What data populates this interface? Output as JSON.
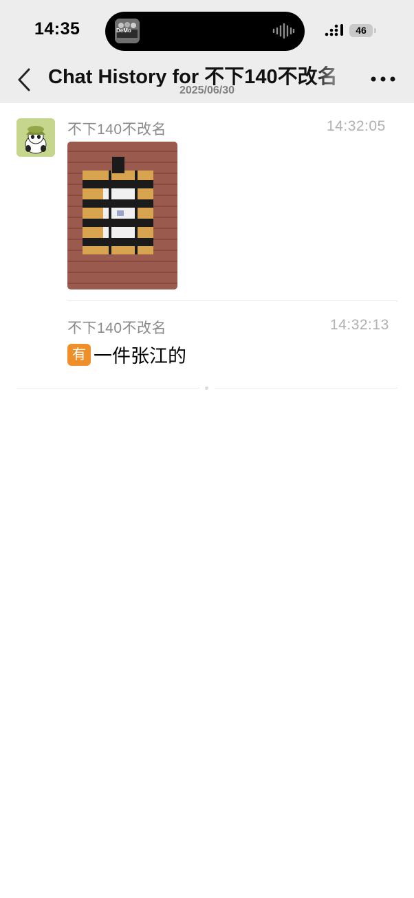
{
  "status_bar": {
    "time": "14:35",
    "battery": "46",
    "island_art_text": "DeMo",
    "icons": [
      "dynamic-island-album-art",
      "audio-waveform-icon",
      "cellular-signal-icon",
      "battery-icon"
    ]
  },
  "header": {
    "title": "Chat History for 不下140不改名",
    "subtitle": "2025/06/30",
    "icons": [
      "chevron-left-icon",
      "more-dots-icon"
    ]
  },
  "messages": [
    {
      "sender": "不下140不改名",
      "time": "14:32:05",
      "type": "image",
      "image_desc_icon": "package-photo"
    },
    {
      "sender": "不下140不改名",
      "time": "14:32:13",
      "type": "text",
      "emoji": "有",
      "text": "一件张江的"
    }
  ],
  "colors": {
    "header_bg": "#ededed",
    "name_gray": "#8a8a8a",
    "time_gray": "#b0b0b0",
    "emoji_orange": "#ef8f2a",
    "avatar_bg": "#c6d68c"
  }
}
